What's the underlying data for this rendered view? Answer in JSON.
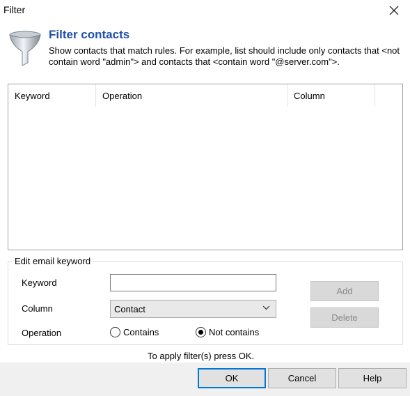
{
  "window": {
    "title": "Filter",
    "close_icon": "close-icon"
  },
  "header": {
    "icon": "funnel-icon",
    "title": "Filter contacts",
    "description": "Show contacts that match rules. For example, list should include only contacts that <not contain word \"admin\"> and contacts that <contain word \"@server.com\">."
  },
  "list": {
    "columns": [
      "Keyword",
      "Operation",
      "Column"
    ],
    "rows": []
  },
  "edit": {
    "group_label": "Edit email keyword",
    "keyword_label": "Keyword",
    "keyword_value": "",
    "column_label": "Column",
    "column_value": "Contact",
    "operation_label": "Operation",
    "op_contains": "Contains",
    "op_not_contains": "Not contains",
    "selected_operation": "Not contains",
    "add_label": "Add",
    "delete_label": "Delete"
  },
  "hint": "To apply filter(s) press OK.",
  "buttons": {
    "ok": "OK",
    "cancel": "Cancel",
    "help": "Help"
  },
  "colors": {
    "accent": "#0078d7",
    "title_blue": "#1f4fa8"
  }
}
